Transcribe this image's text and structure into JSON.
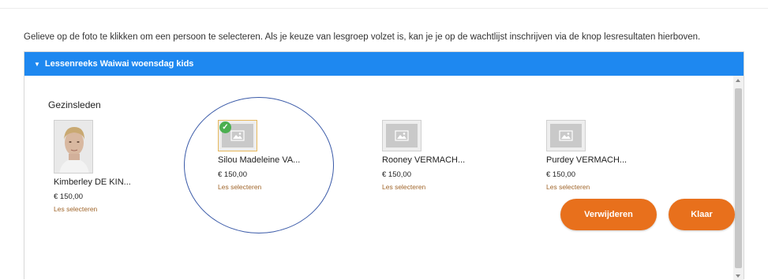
{
  "instructions": "Gelieve op de foto te klikken om een persoon te selecteren. Als je keuze van lesgroep volzet is, kan je je op de wachtlijst inschrijven via de knop lesresultaten hierboven.",
  "panel": {
    "title": "Lessenreeks Waiwai woensdag kids"
  },
  "section_title": "Gezinsleden",
  "members": [
    {
      "name": "Kimberley DE KIN...",
      "price": "€ 150,00",
      "link": "Les selecteren",
      "selected": false,
      "has_photo": true
    },
    {
      "name": "Silou Madeleine VA...",
      "price": "€ 150,00",
      "link": "Les selecteren",
      "selected": true,
      "has_photo": false
    },
    {
      "name": "Rooney VERMACH...",
      "price": "€ 150,00",
      "link": "Les selecteren",
      "selected": false,
      "has_photo": false
    },
    {
      "name": "Purdey VERMACH...",
      "price": "€ 150,00",
      "link": "Les selecteren",
      "selected": false,
      "has_photo": false
    }
  ],
  "buttons": {
    "remove": "Verwijderen",
    "done": "Klaar"
  },
  "colors": {
    "header_blue": "#1e88f0",
    "button_orange": "#e8701c",
    "link_brown": "#a0662b",
    "check_green": "#4caf50",
    "annotation_circle": "#3a5aa8"
  },
  "icons": {
    "header_caret": "caret-down-icon",
    "placeholder": "image-placeholder-icon",
    "selected": "checkmark-icon"
  }
}
